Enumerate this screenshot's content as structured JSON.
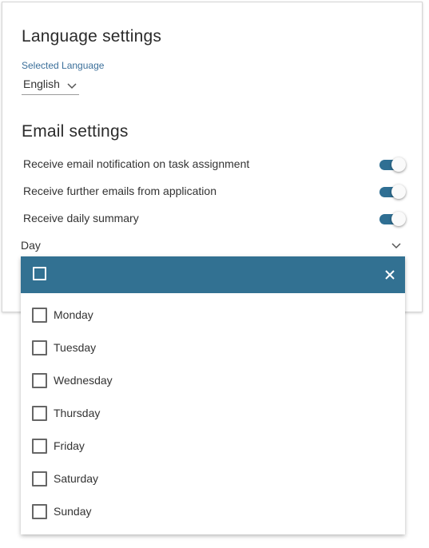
{
  "language": {
    "title": "Language settings",
    "selected_label": "Selected Language",
    "selected_value": "English"
  },
  "email": {
    "title": "Email settings",
    "toggles": [
      {
        "label": "Receive email notification on task assignment",
        "on": true
      },
      {
        "label": "Receive further emails from application",
        "on": true
      },
      {
        "label": "Receive daily summary",
        "on": true
      }
    ],
    "day_select": {
      "value": "Day"
    }
  },
  "dropdown": {
    "options": [
      {
        "label": "Monday",
        "checked": false
      },
      {
        "label": "Tuesday",
        "checked": false
      },
      {
        "label": "Wednesday",
        "checked": false
      },
      {
        "label": "Thursday",
        "checked": false
      },
      {
        "label": "Friday",
        "checked": false
      },
      {
        "label": "Saturday",
        "checked": false
      },
      {
        "label": "Sunday",
        "checked": false
      }
    ]
  },
  "colors": {
    "accent": "#327192",
    "label_blue": "#3b6f9a",
    "toggle_on": "#2f6f93"
  }
}
